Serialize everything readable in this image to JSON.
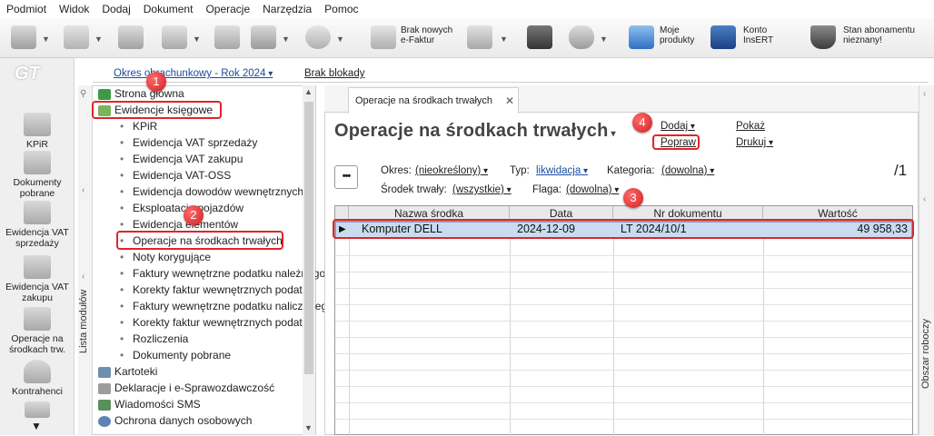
{
  "menu": {
    "items": [
      "Podmiot",
      "Widok",
      "Dodaj",
      "Dokument",
      "Operacje",
      "Narzędzia",
      "Pomoc"
    ]
  },
  "toolbar": {
    "brak_efaktur": "Brak nowych e-Faktur",
    "moje_produkty": "Moje produkty",
    "konto_insert": "Konto InsERT",
    "stan_abonamentu": "Stan abonamentu nieznany!"
  },
  "leftbar": {
    "items": [
      {
        "label": "KPiR",
        "icon": "ledger-icon"
      },
      {
        "label": "Dokumenty pobrane",
        "icon": "download-icon"
      },
      {
        "label": "Ewidencja VAT sprzedaży",
        "icon": "coins-icon"
      },
      {
        "label": "Ewidencja VAT zakupu",
        "icon": "coins-icon"
      },
      {
        "label": "Operacje na środkach trw.",
        "icon": "cash-register-icon"
      },
      {
        "label": "Kontrahenci",
        "icon": "person-icon"
      }
    ]
  },
  "topinfo": {
    "okres": "Okres obrachunkowy - Rok 2024",
    "brak_blokady": "Brak blokady"
  },
  "modules": {
    "side_label": "Lista modułów",
    "tree": [
      {
        "label": "Strona główna",
        "level": 0
      },
      {
        "label": "Ewidencje księgowe",
        "level": 0
      },
      {
        "label": "KPiR",
        "level": 1
      },
      {
        "label": "Ewidencja VAT sprzedaży",
        "level": 1
      },
      {
        "label": "Ewidencja VAT zakupu",
        "level": 1
      },
      {
        "label": "Ewidencja VAT-OSS",
        "level": 1
      },
      {
        "label": "Ewidencja dowodów wewnętrznych",
        "level": 1
      },
      {
        "label": "Eksploatacja pojazdów",
        "level": 1
      },
      {
        "label": "Ewidencja elementów",
        "level": 1
      },
      {
        "label": "Operacje na środkach trwałych",
        "level": 1
      },
      {
        "label": "Noty korygujące",
        "level": 1
      },
      {
        "label": "Faktury wewnętrzne podatku należnego",
        "level": 1
      },
      {
        "label": "Korekty faktur wewnętrznych podatku",
        "level": 1
      },
      {
        "label": "Faktury wewnętrzne podatku naliczonego",
        "level": 1
      },
      {
        "label": "Korekty faktur wewnętrznych podatku",
        "level": 1
      },
      {
        "label": "Rozliczenia",
        "level": 1
      },
      {
        "label": "Dokumenty pobrane",
        "level": 1
      },
      {
        "label": "Kartoteki",
        "level": 0
      },
      {
        "label": "Deklaracje i e-Sprawozdawczość",
        "level": 0
      },
      {
        "label": "Wiadomości SMS",
        "level": 0
      },
      {
        "label": "Ochrona danych osobowych",
        "level": 0
      }
    ]
  },
  "main": {
    "tab_label": "Operacje na środkach trwałych",
    "title": "Operacje na środkach trwałych",
    "dodaj": "Dodaj",
    "popraw": "Popraw",
    "pokaz": "Pokaż",
    "drukuj": "Drukuj",
    "more": "•••",
    "page_count": "/1",
    "filters": {
      "okres_label": "Okres:",
      "okres_value": "(nieokreślony)",
      "typ_label": "Typ:",
      "typ_value": "likwidacja",
      "kategoria_label": "Kategoria:",
      "kategoria_value": "(dowolna)",
      "srodek_label": "Środek trwały:",
      "srodek_value": "(wszystkie)",
      "flaga_label": "Flaga:",
      "flaga_value": "(dowolna)"
    },
    "columns": [
      "Nazwa środka",
      "Data",
      "Nr dokumentu",
      "Wartość"
    ],
    "rows": [
      {
        "nazwa": "Komputer DELL",
        "data": "2024-12-09",
        "nr": "LT 2024/10/1",
        "wartosc": "49 958,33"
      }
    ]
  },
  "right_panel": {
    "label": "Obszar roboczy"
  },
  "badges": [
    "1",
    "2",
    "3",
    "4"
  ],
  "colors": {
    "accent_red": "#e0242a",
    "selection": "#c9dcef",
    "link": "#1a4d9e"
  }
}
